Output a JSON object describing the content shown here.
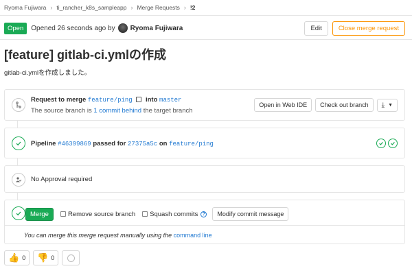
{
  "breadcrumb": {
    "items": [
      "Ryoma Fujiwara",
      "ti_rancher_k8s_sampleapp",
      "Merge Requests",
      "!2"
    ]
  },
  "header": {
    "status": "Open",
    "opened_text": "Opened 26 seconds ago by",
    "author": "Ryoma Fujiwara",
    "edit_label": "Edit",
    "close_label": "Close merge request"
  },
  "title": "[feature] gitlab-ci.ymlの作成",
  "description": "gitlab-ci.ymlを作成しました。",
  "merge_info": {
    "request_text": "Request to merge",
    "source_branch": "feature/ping",
    "into_text": "into",
    "target_branch": "master",
    "behind_prefix": "The source branch is",
    "behind_link": "1 commit behind",
    "behind_suffix": "the target branch",
    "web_ide_label": "Open in Web IDE",
    "checkout_label": "Check out branch"
  },
  "pipeline": {
    "label": "Pipeline",
    "id": "#46399869",
    "passed_text": "passed for",
    "commit": "27375a5c",
    "on_text": "on",
    "branch": "feature/ping"
  },
  "approval": {
    "text": "No Approval required"
  },
  "merge": {
    "merge_label": "Merge",
    "remove_source_label": "Remove source branch",
    "squash_label": "Squash commits",
    "modify_label": "Modify commit message",
    "manual_prefix": "You can merge this merge request manually using the",
    "manual_link": "command line"
  },
  "reactions": {
    "thumbsup_count": "0",
    "thumbsdown_count": "0"
  },
  "colors": {
    "success": "#1aaa55",
    "link": "#1f78d1",
    "warning": "#fc9403"
  }
}
